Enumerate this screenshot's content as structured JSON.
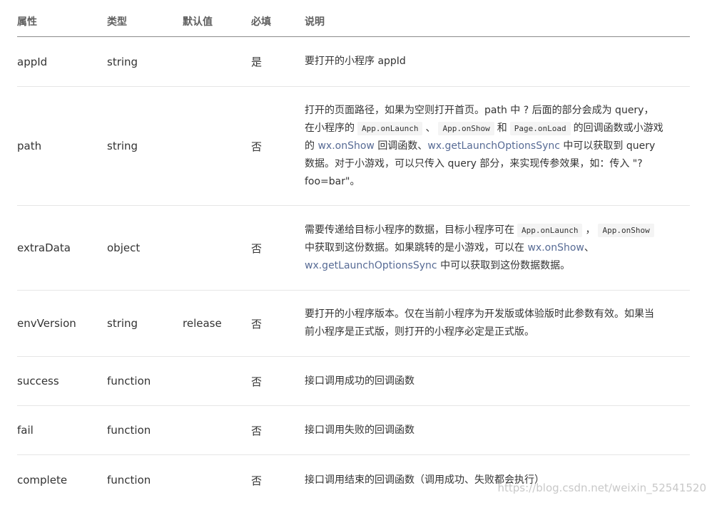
{
  "headers": {
    "attr": "属性",
    "type": "类型",
    "default": "默认值",
    "required": "必填",
    "desc": "说明"
  },
  "rows": {
    "appid": {
      "attr": "appId",
      "type": "string",
      "default": "",
      "required": "是",
      "desc": "要打开的小程序 appId"
    },
    "path": {
      "attr": "path",
      "type": "string",
      "default": "",
      "required": "否",
      "d1": "打开的页面路径，如果为空则打开首页。path 中 ? 后面的部分会成为 query，",
      "d2": "在小程序的",
      "code1": "App.onLaunch",
      "sep1": "、",
      "code2": "App.onShow",
      "and": "和",
      "code3": "Page.onLoad",
      "d3": "的回调函数或小游戏",
      "d4": "的",
      "link1": "wx.onShow",
      "d5": "回调函数、",
      "link2": "wx.getLaunchOptionsSync",
      "d6": "中可以获取到 query",
      "d7": "数据。对于小游戏，可以只传入 query 部分，来实现传参效果，如：传入 \"?",
      "d8": "foo=bar\"。"
    },
    "extra": {
      "attr": "extraData",
      "type": "object",
      "default": "",
      "required": "否",
      "d1": "需要传递给目标小程序的数据，目标小程序可在",
      "code1": "App.onLaunch",
      "sep1": "，",
      "code2": "App.onShow",
      "d2": "中获取到这份数据。如果跳转的是小游戏，可以在",
      "link1": "wx.onShow",
      "sep2": "、",
      "link2": "wx.getLaunchOptionsSync",
      "d3": "中可以获取到这份数据数据。"
    },
    "env": {
      "attr": "envVersion",
      "type": "string",
      "default": "release",
      "required": "否",
      "d1": "要打开的小程序版本。仅在当前小程序为开发版或体验版时此参数有效。如果当",
      "d2": "前小程序是正式版，则打开的小程序必定是正式版。"
    },
    "success": {
      "attr": "success",
      "type": "function",
      "default": "",
      "required": "否",
      "desc": "接口调用成功的回调函数"
    },
    "fail": {
      "attr": "fail",
      "type": "function",
      "default": "",
      "required": "否",
      "desc": "接口调用失败的回调函数"
    },
    "complete": {
      "attr": "complete",
      "type": "function",
      "default": "",
      "required": "否",
      "desc": "接口调用结束的回调函数（调用成功、失败都会执行）"
    }
  },
  "watermark": "https://blog.csdn.net/weixin_52541520",
  "colors": {
    "link": "#576b95",
    "header_border": "#8a8a8a",
    "row_border": "#e6e6e6"
  }
}
